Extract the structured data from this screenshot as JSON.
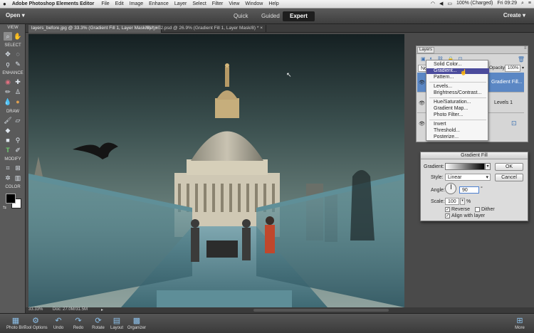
{
  "menubar": {
    "app_name": "Adobe Photoshop Elements Editor",
    "items": [
      "File",
      "Edit",
      "Image",
      "Enhance",
      "Layer",
      "Select",
      "Filter",
      "View",
      "Window",
      "Help"
    ],
    "battery": "100% (Charged)",
    "clock": "Fri 09:29"
  },
  "modebar": {
    "open_label": "Open",
    "modes": [
      "Quick",
      "Guided",
      "Expert"
    ],
    "active_mode": "Expert",
    "create_label": "Create"
  },
  "toolbox": {
    "sections": [
      "VIEW",
      "SELECT",
      "ENHANCE",
      "DRAW",
      "MODIFY",
      "COLOR"
    ]
  },
  "tabs": [
    {
      "label": "layers_before.jpg @ 33.3% (Gradient Fill 1, Layer Mask/8) *"
    },
    {
      "label": "image02.psd @ 26.9% (Gradient Fill 1, Layer Mask/8) *"
    }
  ],
  "status": {
    "zoom": "33.33%",
    "doc": "Doc: 27.0M/31.5M"
  },
  "layers_panel": {
    "tab_label": "Layers",
    "blend_mode_short": "Nor",
    "opacity_label": "Opacity:",
    "opacity_value": "100%",
    "rows": [
      {
        "name": "Gradient Fill..."
      },
      {
        "name": "Levels 1"
      }
    ]
  },
  "adjust_menu": {
    "items": [
      {
        "label": "Solid Color...",
        "highlighted": false
      },
      {
        "label": "Gradient...",
        "highlighted": true
      },
      {
        "label": "Pattern...",
        "highlighted": false
      },
      {
        "label": "Levels...",
        "highlighted": false
      },
      {
        "label": "Brightness/Contrast...",
        "highlighted": false
      },
      {
        "label": "Hue/Saturation...",
        "highlighted": false
      },
      {
        "label": "Gradient Map...",
        "highlighted": false
      },
      {
        "label": "Photo Filter...",
        "highlighted": false
      },
      {
        "label": "Invert",
        "highlighted": false
      },
      {
        "label": "Threshold...",
        "highlighted": false
      },
      {
        "label": "Posterize...",
        "highlighted": false
      }
    ]
  },
  "gradient_dialog": {
    "title": "Gradient Fill",
    "gradient_label": "Gradient:",
    "style_label": "Style:",
    "style_value": "Linear",
    "angle_label": "Angle:",
    "angle_value": "90",
    "degree_symbol": "°",
    "scale_label": "Scale:",
    "scale_value": "100",
    "percent_symbol": "%",
    "reverse_label": "Reverse",
    "reverse_checked": true,
    "dither_label": "Dither",
    "dither_checked": false,
    "align_label": "Align with layer",
    "align_checked": true,
    "ok_label": "OK",
    "cancel_label": "Cancel"
  },
  "bottombar": {
    "items": [
      "Photo Bin",
      "Tool Options",
      "Undo",
      "Redo",
      "Rotate",
      "Layout",
      "Organizer"
    ],
    "more_label": "More"
  },
  "colors": {
    "accent": "#4b4b9c",
    "layer_selected": "#5b87c4",
    "mode_active_bg": "#1e1e1e"
  }
}
